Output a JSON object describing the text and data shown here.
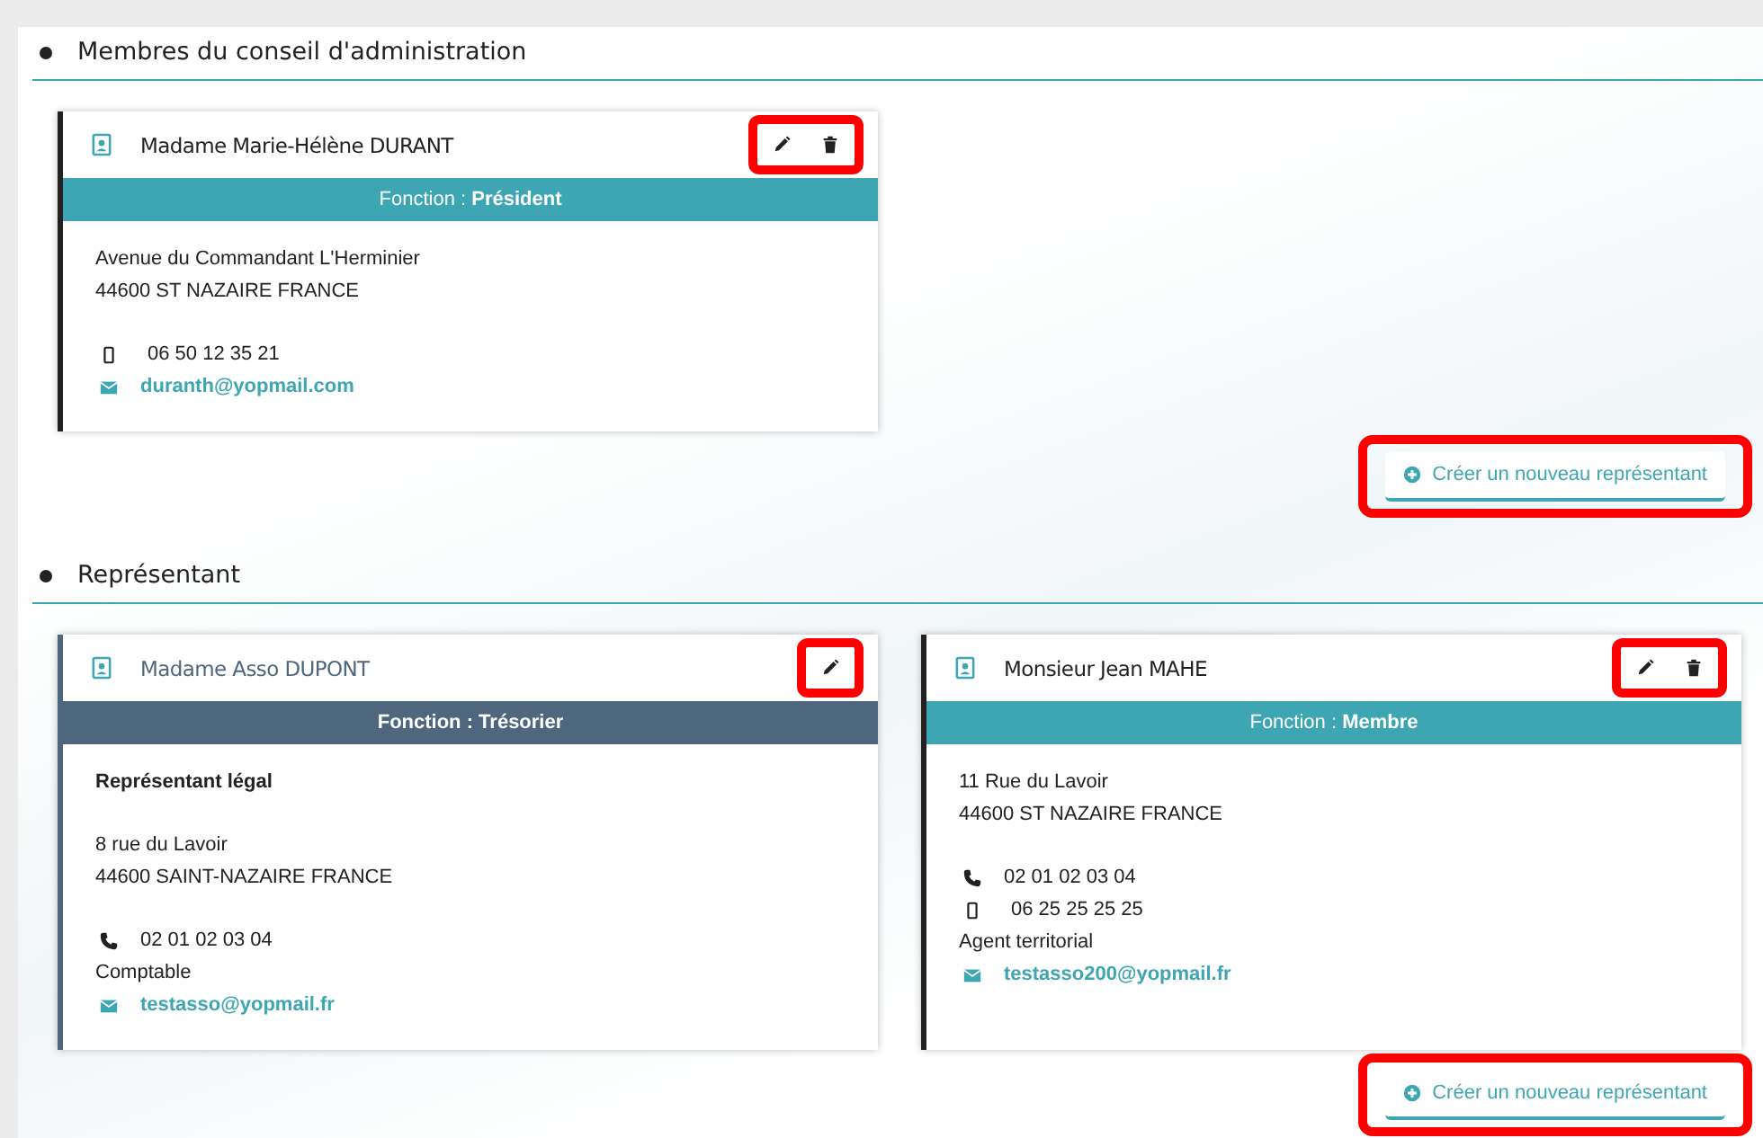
{
  "sections": [
    {
      "title": "Membres du conseil d'administration",
      "cards": [
        {
          "kind": "member",
          "name": "Madame Marie-Hélène DURANT",
          "function": "Fonction : **Président**",
          "actions": [
            {
              "kind": "edit"
            },
            {
              "kind": "delete"
            }
          ],
          "actions_highlighted": true,
          "blocks": [
            [
              {
                "kind": "text",
                "text": "Avenue du Commandant L'Herminier"
              },
              {
                "kind": "text",
                "text": "44600 ST NAZAIRE FRANCE"
              }
            ],
            [
              {
                "kind": "mobile",
                "text": "06 50 12 35 21"
              },
              {
                "kind": "email",
                "text": "duranth@yopmail.com"
              }
            ]
          ]
        }
      ],
      "button": {
        "label": "Créer un nouveau représentant",
        "highlighted": true
      }
    },
    {
      "title": "Représentant",
      "cards": [
        {
          "kind": "legal",
          "name": "Madame Asso DUPONT",
          "function": "Fonction : Trésorier",
          "actions": [
            {
              "kind": "edit"
            }
          ],
          "actions_highlighted": true,
          "blocks": [
            [
              {
                "kind": "bold",
                "text": "Représentant légal"
              }
            ],
            [
              {
                "kind": "text",
                "text": "8 rue du Lavoir"
              },
              {
                "kind": "text",
                "text": "44600 SAINT-NAZAIRE FRANCE"
              }
            ],
            [
              {
                "kind": "phone",
                "text": "02 01 02 03 04"
              },
              {
                "kind": "text",
                "text": "Comptable"
              },
              {
                "kind": "email",
                "text": "testasso@yopmail.fr"
              }
            ]
          ]
        },
        {
          "kind": "member",
          "name": "Monsieur Jean MAHE",
          "function": "Fonction : **Membre**",
          "actions": [
            {
              "kind": "edit"
            },
            {
              "kind": "delete"
            }
          ],
          "actions_highlighted": true,
          "blocks": [
            [
              {
                "kind": "text",
                "text": "11 Rue du Lavoir"
              },
              {
                "kind": "text",
                "text": "44600 ST NAZAIRE FRANCE"
              }
            ],
            [
              {
                "kind": "phone",
                "text": "02 01 02 03 04"
              },
              {
                "kind": "mobile",
                "text": "06 25 25 25 25"
              },
              {
                "kind": "text",
                "text": "Agent territorial"
              },
              {
                "kind": "email",
                "text": "testasso200@yopmail.fr"
              }
            ]
          ]
        }
      ],
      "button": {
        "label": "Créer un nouveau représentant",
        "highlighted": true
      }
    }
  ]
}
